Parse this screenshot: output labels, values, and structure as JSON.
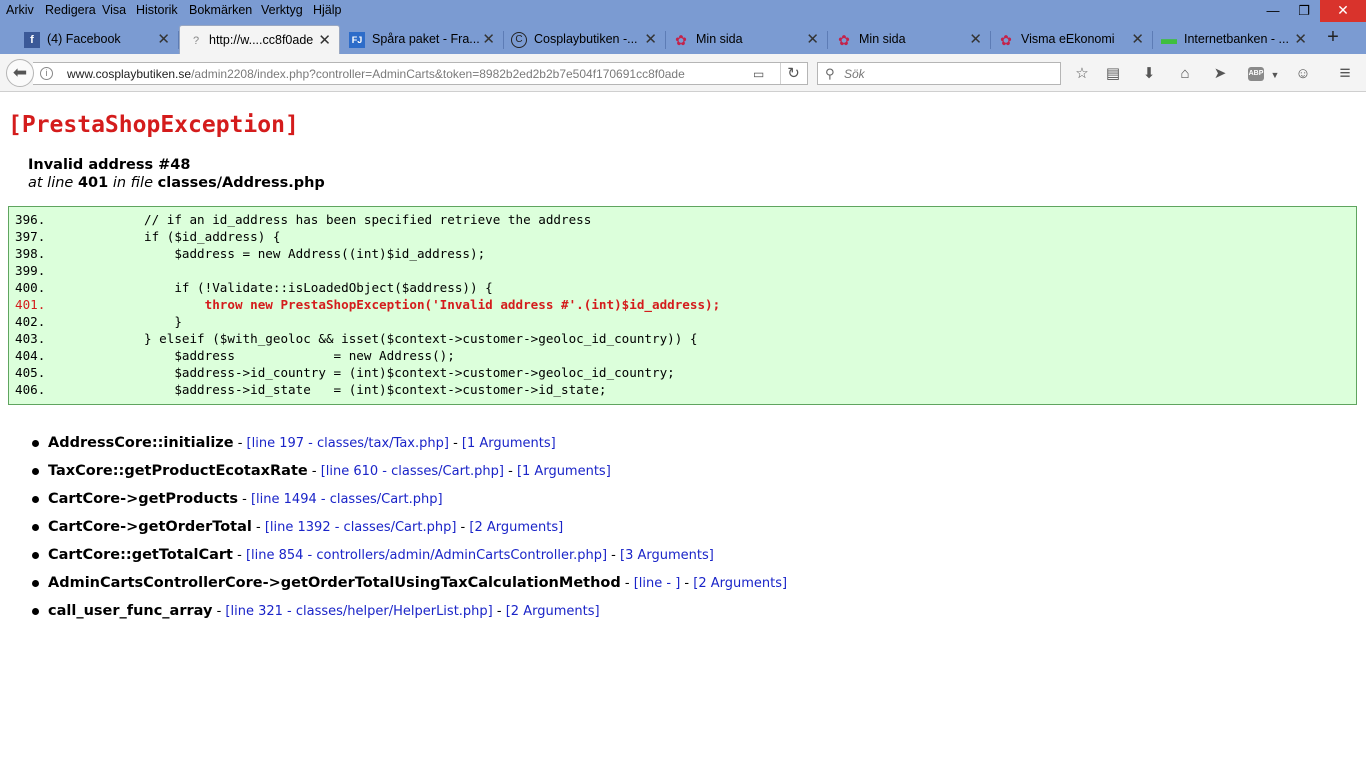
{
  "menubar": {
    "items": [
      "Arkiv",
      "Redigera",
      "Visa",
      "Historik",
      "Bokmärken",
      "Verktyg",
      "Hjälp"
    ],
    "minimize": "—",
    "restore": "❐",
    "close": "✕"
  },
  "tabs": [
    {
      "title": "(4) Facebook",
      "icon": "f",
      "icon_color": "#3b5998"
    },
    {
      "title": "http://w....cc8f0ade",
      "icon": "?",
      "icon_color": "#888888"
    },
    {
      "title": "Spåra paket - Fra...",
      "icon": "FJ",
      "icon_color": "#2d6cc9"
    },
    {
      "title": "Cosplaybutiken -...",
      "icon": "C",
      "icon_color": "#222222"
    },
    {
      "title": "Min sida",
      "icon": "✿",
      "icon_color": "#c4224a"
    },
    {
      "title": "Min sida",
      "icon": "✿",
      "icon_color": "#c4224a"
    },
    {
      "title": "Visma eEkonomi",
      "icon": "✿",
      "icon_color": "#c4224a"
    },
    {
      "title": "Internetbanken - ...",
      "icon": "▬",
      "icon_color": "#3fbf3f"
    }
  ],
  "tab_close": "✕",
  "new_tab": "+",
  "navbar": {
    "back": "⬅",
    "url_host": "www.cosplaybutiken.se",
    "url_path": "/admin2208/index.php?controller=AdminCarts&token=8982b2ed2b2b7e504f170691cc8f0ade",
    "search_placeholder": "Sök",
    "reload": "↻",
    "reader": "▭",
    "icons": [
      "☆",
      "▤",
      "⬇",
      "⌂",
      "➤",
      "ABP",
      "☺",
      "≡"
    ]
  },
  "page": {
    "exception_title": "[PrestaShopException]",
    "error_message": "Invalid address #48",
    "location": {
      "at_line_label": "at line",
      "line": "401",
      "in_file_label": "in file",
      "file": "classes/Address.php"
    },
    "code_lines": [
      {
        "num": "396.",
        "code": "            // if an id_address has been specified retrieve the address",
        "error": false
      },
      {
        "num": "397.",
        "code": "            if ($id_address) {",
        "error": false
      },
      {
        "num": "398.",
        "code": "                $address = new Address((int)$id_address);",
        "error": false
      },
      {
        "num": "399.",
        "code": "",
        "error": false
      },
      {
        "num": "400.",
        "code": "                if (!Validate::isLoadedObject($address)) {",
        "error": false
      },
      {
        "num": "401.",
        "code": "                    throw new PrestaShopException('Invalid address #'.(int)$id_address);",
        "error": true
      },
      {
        "num": "402.",
        "code": "                }",
        "error": false
      },
      {
        "num": "403.",
        "code": "            } elseif ($with_geoloc && isset($context->customer->geoloc_id_country)) {",
        "error": false
      },
      {
        "num": "404.",
        "code": "                $address             = new Address();",
        "error": false
      },
      {
        "num": "405.",
        "code": "                $address->id_country = (int)$context->customer->geoloc_id_country;",
        "error": false
      },
      {
        "num": "406.",
        "code": "                $address->id_state   = (int)$context->customer->id_state;",
        "error": false
      }
    ],
    "trace": [
      {
        "fn": "AddressCore::initialize",
        "link": "[line 197 - classes/tax/Tax.php]",
        "args": "[1 Arguments]"
      },
      {
        "fn": "TaxCore::getProductEcotaxRate",
        "link": "[line 610 - classes/Cart.php]",
        "args": "[1 Arguments]"
      },
      {
        "fn": "CartCore->getProducts",
        "link": "[line 1494 - classes/Cart.php]",
        "args": ""
      },
      {
        "fn": "CartCore->getOrderTotal",
        "link": "[line 1392 - classes/Cart.php]",
        "args": "[2 Arguments]"
      },
      {
        "fn": "CartCore::getTotalCart",
        "link": "[line 854 - controllers/admin/AdminCartsController.php]",
        "args": "[3 Arguments]"
      },
      {
        "fn": "AdminCartsControllerCore->getOrderTotalUsingTaxCalculationMethod",
        "link": "[line - ]",
        "args": "[2 Arguments]"
      },
      {
        "fn": "call_user_func_array",
        "link": "[line 321 - classes/helper/HelperList.php]",
        "args": "[2 Arguments]"
      }
    ]
  }
}
